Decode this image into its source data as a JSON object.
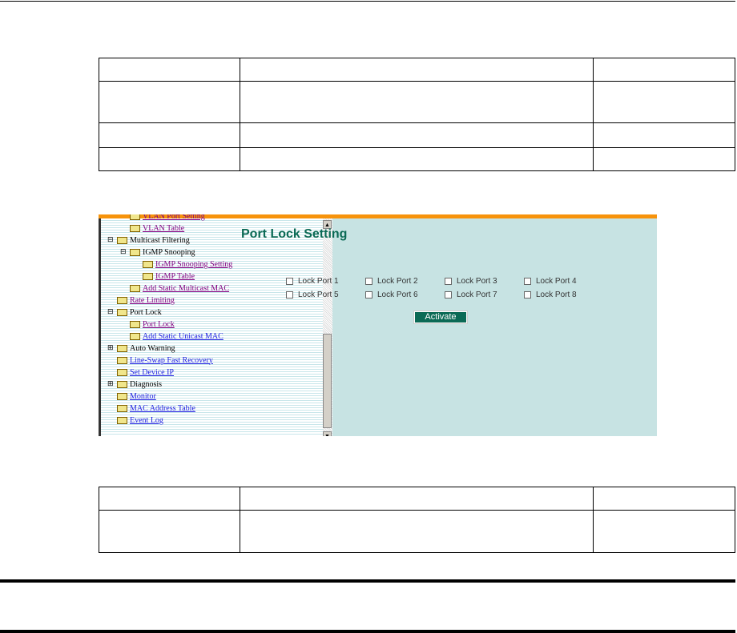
{
  "sidebar": {
    "items": [
      {
        "label": "VLAN Port Setting",
        "indent": 2,
        "type": "link-visited"
      },
      {
        "label": "VLAN Table",
        "indent": 2,
        "type": "link-visited"
      },
      {
        "label": "Multicast Filtering",
        "indent": 1,
        "type": "group-open"
      },
      {
        "label": "IGMP Snooping",
        "indent": 2,
        "type": "group-open"
      },
      {
        "label": "IGMP Snooping Setting",
        "indent": 3,
        "type": "link-visited"
      },
      {
        "label": "IGMP Table",
        "indent": 3,
        "type": "link-visited"
      },
      {
        "label": "Add Static Multicast MAC",
        "indent": 2,
        "type": "link-visited"
      },
      {
        "label": "Rate Limiting",
        "indent": 1,
        "type": "link-visited"
      },
      {
        "label": "Port Lock",
        "indent": 1,
        "type": "group-open"
      },
      {
        "label": "Port Lock",
        "indent": 2,
        "type": "link-visited"
      },
      {
        "label": "Add Static Unicast MAC",
        "indent": 2,
        "type": "link"
      },
      {
        "label": "Auto Warning",
        "indent": 1,
        "type": "group-closed"
      },
      {
        "label": "Line-Swap Fast Recovery",
        "indent": 1,
        "type": "link"
      },
      {
        "label": "Set Device IP",
        "indent": 1,
        "type": "link"
      },
      {
        "label": "Diagnosis",
        "indent": 1,
        "type": "group-closed"
      },
      {
        "label": "Monitor",
        "indent": 1,
        "type": "link"
      },
      {
        "label": "MAC Address Table",
        "indent": 1,
        "type": "link"
      },
      {
        "label": "Event Log",
        "indent": 1,
        "type": "link"
      }
    ]
  },
  "main": {
    "title": "Port Lock Setting",
    "ports": [
      "Lock Port 1",
      "Lock Port 2",
      "Lock Port 3",
      "Lock Port 4",
      "Lock Port 5",
      "Lock Port 6",
      "Lock Port 7",
      "Lock Port 8"
    ],
    "activate_label": "Activate"
  },
  "colors": {
    "accent": "#0b6a55",
    "orange": "#f7930b",
    "panel": "#c7e3e3"
  }
}
